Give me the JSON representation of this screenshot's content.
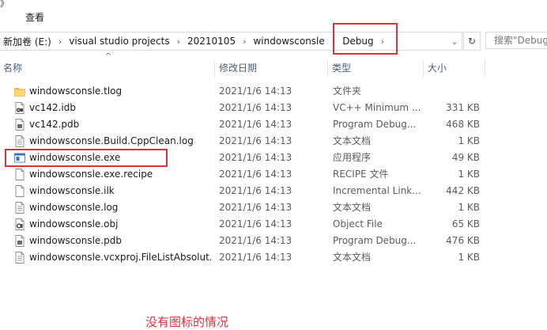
{
  "ribbon": {
    "top_mark": "》",
    "view_tab": "查看"
  },
  "address": {
    "crumbs": [
      "新加卷 (E:)",
      "visual studio projects",
      "20210105",
      "windowsconsle",
      "Debug"
    ],
    "separator": "›",
    "dropdown": "⌄",
    "refresh_glyph": "↻"
  },
  "search": {
    "placeholder": "搜索\"Debug\""
  },
  "columns": {
    "name": "名称",
    "date": "修改日期",
    "type": "类型",
    "size": "大小",
    "sort_arrow": "^"
  },
  "files": [
    {
      "name": "windowsconsle.tlog",
      "date": "2021/1/6 14:13",
      "type": "文件夹",
      "size": "",
      "icon": "folder-icon"
    },
    {
      "name": "vc142.idb",
      "date": "2021/1/6 14:13",
      "type": "VC++ Minimum ...",
      "size": "331 KB",
      "icon": "idb-file-icon"
    },
    {
      "name": "vc142.pdb",
      "date": "2021/1/6 14:13",
      "type": "Program Debug...",
      "size": "468 KB",
      "icon": "pdb-file-icon"
    },
    {
      "name": "windowsconsle.Build.CppClean.log",
      "date": "2021/1/6 14:13",
      "type": "文本文档",
      "size": "1 KB",
      "icon": "text-file-icon"
    },
    {
      "name": "windowsconsle.exe",
      "date": "2021/1/6 14:13",
      "type": "应用程序",
      "size": "49 KB",
      "icon": "exe-file-icon"
    },
    {
      "name": "windowsconsle.exe.recipe",
      "date": "2021/1/6 14:13",
      "type": "RECIPE 文件",
      "size": "1 KB",
      "icon": "blank-file-icon"
    },
    {
      "name": "windowsconsle.ilk",
      "date": "2021/1/6 14:13",
      "type": "Incremental Link...",
      "size": "442 KB",
      "icon": "blank-file-icon"
    },
    {
      "name": "windowsconsle.log",
      "date": "2021/1/6 14:13",
      "type": "文本文档",
      "size": "1 KB",
      "icon": "text-file-icon"
    },
    {
      "name": "windowsconsle.obj",
      "date": "2021/1/6 14:13",
      "type": "Object File",
      "size": "65 KB",
      "icon": "obj-file-icon"
    },
    {
      "name": "windowsconsle.pdb",
      "date": "2021/1/6 14:13",
      "type": "Program Debug...",
      "size": "476 KB",
      "icon": "pdb-file-icon"
    },
    {
      "name": "windowsconsle.vcxproj.FileListAbsolut...",
      "date": "2021/1/6 14:13",
      "type": "文本文档",
      "size": "1 KB",
      "icon": "text-file-icon"
    }
  ],
  "caption": "没有图标的情况",
  "colors": {
    "highlight": "#e0303b",
    "header_text": "#4c607a",
    "folder": "#f5c24c"
  }
}
